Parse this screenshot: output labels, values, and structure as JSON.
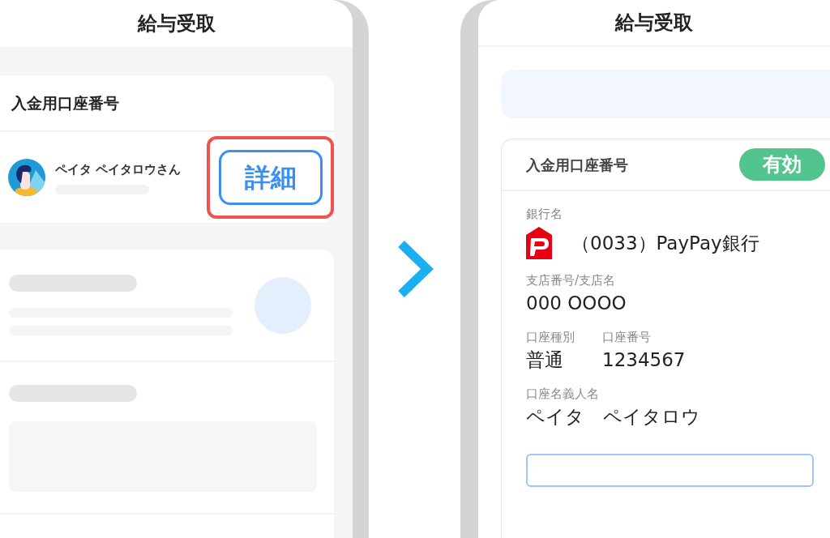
{
  "left_screen": {
    "title": "給与受取",
    "account_card": {
      "heading": "入金用口座番号",
      "holder_name": "ペイタ ペイタロウさん",
      "detail_button": {
        "label": "詳細",
        "highlighted": true
      }
    }
  },
  "right_screen": {
    "title": "給与受取",
    "account_card": {
      "heading": "入金用口座番号",
      "status_badge": "有効",
      "rows": [
        {
          "fields": [
            {
              "kind": "bank",
              "label": "銀行名",
              "value": "（0033）PayPay銀行"
            }
          ]
        },
        {
          "fields": [
            {
              "kind": "text",
              "label": "支店番号/支店名",
              "value": "000 OOOO"
            }
          ]
        },
        {
          "fields": [
            {
              "kind": "text",
              "label": "口座種別",
              "value": "普通"
            },
            {
              "kind": "text",
              "label": "口座番号",
              "value": "1234567"
            }
          ]
        },
        {
          "fields": [
            {
              "kind": "text",
              "label": "口座名義人名",
              "value": "ペイタ　ペイタロウ"
            }
          ]
        }
      ]
    }
  }
}
